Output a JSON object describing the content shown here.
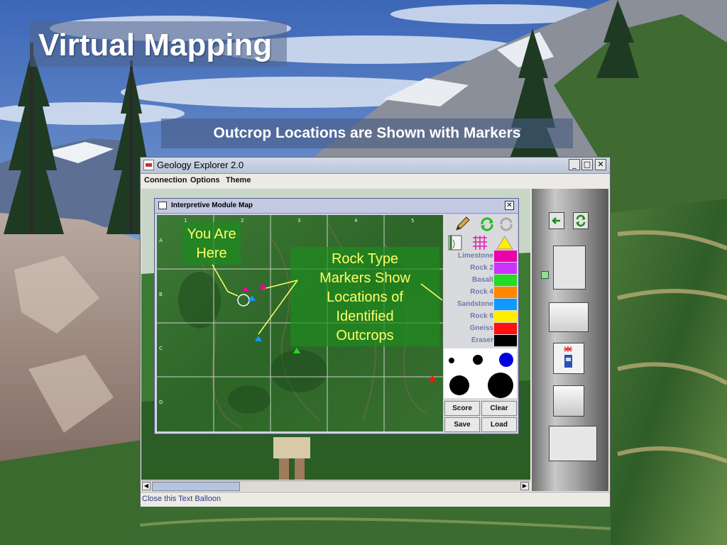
{
  "slide": {
    "title": "Virtual Mapping",
    "subtitle": "Outcrop Locations are Shown with Markers"
  },
  "window": {
    "title": "Geology Explorer 2.0",
    "minimize_label": "_",
    "maximize_label": "□",
    "close_label": "✕",
    "menus": [
      "Connection",
      "Options",
      "Theme"
    ],
    "status_text": "Close this Text Balloon"
  },
  "map_window": {
    "title": "Interpretive Module Map",
    "close_label": "✕",
    "column_labels": [
      "1",
      "2",
      "3",
      "4",
      "5"
    ],
    "row_labels": [
      "A",
      "B",
      "C",
      "D"
    ],
    "callouts": {
      "you_are_here": [
        "You Are",
        "Here"
      ],
      "rock_markers": [
        "Rock Type",
        "Markers Show",
        "Locations of",
        "Identified",
        "Outcrops"
      ]
    },
    "rocks": [
      {
        "label": "Limestone",
        "color": "#ee00aa"
      },
      {
        "label": "Rock 2",
        "color": "#cc33ff"
      },
      {
        "label": "Basalt",
        "color": "#22dd22"
      },
      {
        "label": "Rock 4",
        "color": "#ff8800"
      },
      {
        "label": "Sandstone",
        "color": "#1199ff"
      },
      {
        "label": "Rock 6",
        "color": "#ffee00"
      },
      {
        "label": "Gneiss",
        "color": "#ff1111"
      },
      {
        "label": "Eraser",
        "color": "#000000"
      }
    ],
    "buttons": {
      "score": "Score",
      "clear": "Clear",
      "save": "Save",
      "load": "Load"
    }
  },
  "colors": {
    "window_bg": "#eceae4",
    "map_panel_bg": "#cfd3e6",
    "callout_text": "#ffff66",
    "menu_text": "#111111",
    "rock_label_text": "#6d7cab"
  },
  "icons": [
    "pencil-icon",
    "refresh-icon",
    "rotate-icon",
    "book-icon",
    "grid-icon",
    "triangle-icon",
    "back-arrow-icon",
    "sync-icon",
    "inventory-item-icon"
  ]
}
